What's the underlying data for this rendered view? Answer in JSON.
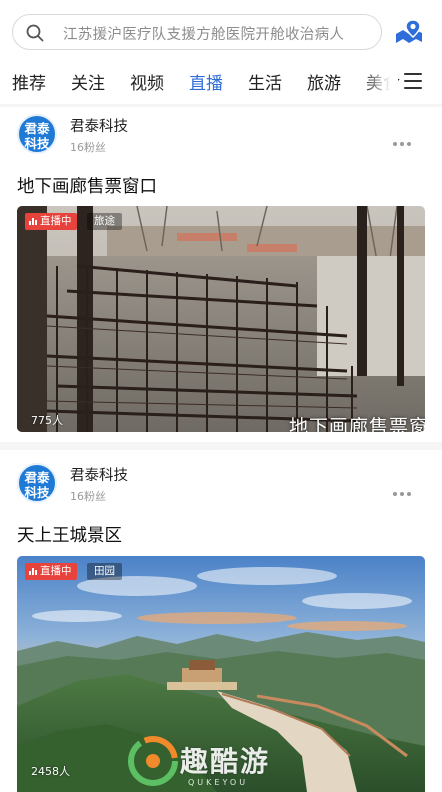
{
  "search": {
    "placeholder": "江苏援沪医疗队支援方舱医院开舱收治病人"
  },
  "tabs": [
    {
      "label": "推荐",
      "active": false
    },
    {
      "label": "关注",
      "active": false
    },
    {
      "label": "视频",
      "active": false
    },
    {
      "label": "直播",
      "active": true
    },
    {
      "label": "生活",
      "active": false
    },
    {
      "label": "旅游",
      "active": false
    },
    {
      "label": "美食",
      "active": false
    }
  ],
  "posts": [
    {
      "author": "君泰科技",
      "avatar_text": [
        "君泰",
        "科技"
      ],
      "fans": "16粉丝",
      "title": "地下画廊售票窗口",
      "live_label": "直播中",
      "category": "旅途",
      "viewers": "775人",
      "caption": "地下画廊售票窗"
    },
    {
      "author": "君泰科技",
      "avatar_text": [
        "君泰",
        "科技"
      ],
      "fans": "16粉丝",
      "title": "天上王城景区",
      "live_label": "直播中",
      "category": "田园",
      "viewers": "2458人"
    }
  ],
  "watermark": {
    "text": "趣酷游",
    "sub": "QUKEYOU"
  },
  "colors": {
    "accent": "#2f6ed8",
    "live": "#e8423c",
    "avatar": "#1f7ad6"
  }
}
